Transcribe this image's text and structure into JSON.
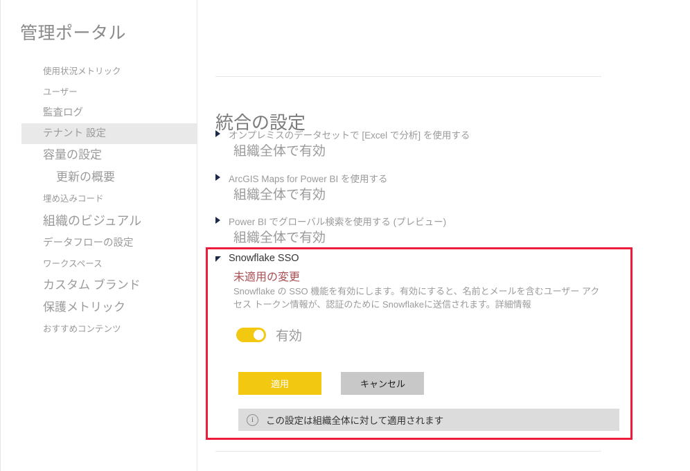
{
  "app": {
    "portal_title": "管理ポータル"
  },
  "sidebar": {
    "items": [
      {
        "label": "使用状況メトリック",
        "size": "small",
        "selected": false
      },
      {
        "label": "ユーザー",
        "size": "small",
        "selected": false
      },
      {
        "label": "監査ログ",
        "size": "medium",
        "selected": false
      },
      {
        "label": "テナント 設定",
        "size": "medium",
        "selected": true
      },
      {
        "label": "容量の設定",
        "size": "large",
        "selected": false
      },
      {
        "label": "更新の概要",
        "size": "large",
        "selected": false
      },
      {
        "label": "埋め込みコード",
        "size": "small",
        "selected": false
      },
      {
        "label": "組織のビジュアル",
        "size": "xlarge",
        "selected": false
      },
      {
        "label": "データフローの設定",
        "size": "medium",
        "selected": false
      },
      {
        "label": "ワークスペース",
        "size": "small",
        "selected": false
      },
      {
        "label": "カスタム ブランド",
        "size": "large",
        "selected": false
      },
      {
        "label": "保護メトリック",
        "size": "large",
        "selected": false
      },
      {
        "label": "おすすめコンテンツ",
        "size": "small",
        "selected": false
      }
    ]
  },
  "main": {
    "section_title": "統合の設定",
    "collapsed_settings": [
      {
        "name": "オンプレミスのデータセットで [Excel で分析] を使用する",
        "state": "組織全体で有効"
      },
      {
        "name": "ArcGIS Maps for Power BI を使用する",
        "state": "組織全体で有効"
      },
      {
        "name": "Power BI でグローバル検索を使用する (プレビュー)",
        "state": "組織全体で有効"
      }
    ],
    "expanded_setting": {
      "title": "Snowflake SSO",
      "pending_label": "未適用の変更",
      "description": "Snowflake の SSO 機能を有効にします。有効にすると、名前とメールを含むユーザー アクセス トークン情報が、認証のために Snowflakeに送信されます。詳細情報",
      "toggle": {
        "label": "有効",
        "state": "on",
        "on_color": "#f2c811"
      },
      "apply_button": "適用",
      "cancel_button": "キャンセル",
      "info_message": "この設定は組織全体に対して適用されます",
      "info_icon": "info-icon"
    }
  },
  "highlight": {
    "color": "#ec1c3a"
  }
}
